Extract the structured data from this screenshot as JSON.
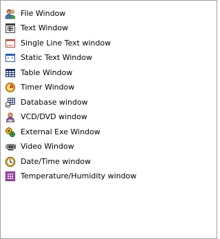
{
  "menu": {
    "items": [
      {
        "label": "File Window",
        "icon": "file-window-icon"
      },
      {
        "label": "Text Window",
        "icon": "text-window-icon"
      },
      {
        "label": "Single Line Text window",
        "icon": "single-line-text-icon"
      },
      {
        "label": "Static Text Window",
        "icon": "static-text-icon"
      },
      {
        "label": "Table Window",
        "icon": "table-window-icon"
      },
      {
        "label": "Timer Window",
        "icon": "timer-icon"
      },
      {
        "label": "Database window",
        "icon": "database-icon"
      },
      {
        "label": "VCD/DVD window",
        "icon": "vcd-dvd-icon"
      },
      {
        "label": "External Exe Window",
        "icon": "external-exe-icon"
      },
      {
        "label": "Video Window",
        "icon": "video-window-icon"
      },
      {
        "label": "Date/Time window",
        "icon": "clock-icon"
      },
      {
        "label": "Temperature/Humidity window",
        "icon": "temperature-humidity-icon"
      }
    ]
  },
  "colors": {
    "border": "#a0a0a0",
    "text": "#000000",
    "background": "#ffffff"
  }
}
